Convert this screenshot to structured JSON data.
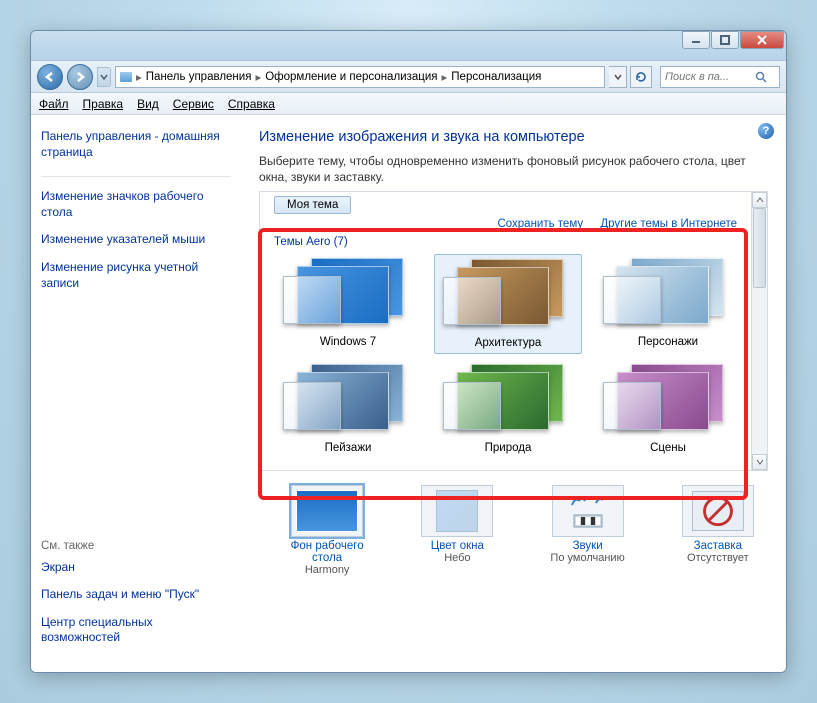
{
  "breadcrumbs": [
    "Панель управления",
    "Оформление и персонализация",
    "Персонализация"
  ],
  "search_placeholder": "Поиск в па...",
  "menu": {
    "file": "Файл",
    "edit": "Правка",
    "view": "Вид",
    "service": "Сервис",
    "help": "Справка"
  },
  "sidebar": {
    "home": "Панель управления - домашняя страница",
    "links": [
      "Изменение значков рабочего стола",
      "Изменение указателей мыши",
      "Изменение рисунка учетной записи"
    ],
    "seealso_header": "См. также",
    "seealso": [
      "Экран",
      "Панель задач и меню \"Пуск\"",
      "Центр специальных возможностей"
    ]
  },
  "main": {
    "title": "Изменение изображения и звука на компьютере",
    "subtitle": "Выберите тему, чтобы одновременно изменить фоновый рисунок рабочего стола, цвет окна, звуки и заставку.",
    "my_theme": "Моя тема",
    "save_theme": "Сохранить тему",
    "online_themes": "Другие темы в Интернете",
    "aero_header": "Темы Aero (7)",
    "themes": [
      {
        "label": "Windows 7",
        "c1": "#1a6dc4",
        "c2": "#4896e0"
      },
      {
        "label": "Архитектура",
        "c1": "#7a5832",
        "c2": "#c79a5e",
        "selected": true
      },
      {
        "label": "Персонажи",
        "c1": "#7aa8cc",
        "c2": "#d4e4ef"
      },
      {
        "label": "Пейзажи",
        "c1": "#3a5f8a",
        "c2": "#8ab4d8"
      },
      {
        "label": "Природа",
        "c1": "#2a6a2f",
        "c2": "#6fb84c"
      },
      {
        "label": "Сцены",
        "c1": "#8a4a8e",
        "c2": "#c88fcc"
      }
    ]
  },
  "bottom": [
    {
      "name": "Фон рабочего стола",
      "value": "Harmony",
      "key": "desktop-bg"
    },
    {
      "name": "Цвет окна",
      "value": "Небо",
      "key": "window-color"
    },
    {
      "name": "Звуки",
      "value": "По умолчанию",
      "key": "sounds"
    },
    {
      "name": "Заставка",
      "value": "Отсутствует",
      "key": "screensaver"
    }
  ]
}
